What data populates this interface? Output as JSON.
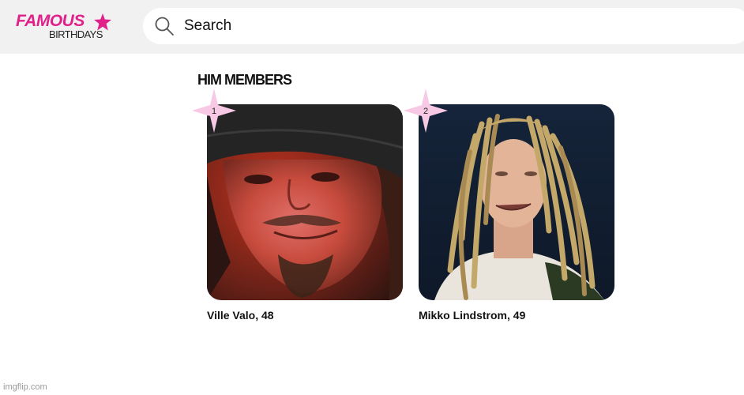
{
  "brand": {
    "logo_top": "FAMOUS",
    "logo_bottom": "BIRTHDAYS",
    "accent_color": "#e0218a"
  },
  "search": {
    "placeholder": "Search",
    "icon": "search-icon"
  },
  "section": {
    "title": "HIM MEMBERS"
  },
  "members": [
    {
      "rank": "1",
      "name": "Ville Valo, 48"
    },
    {
      "rank": "2",
      "name": "Mikko Lindstrom, 49"
    }
  ],
  "watermark": "imgflip.com"
}
